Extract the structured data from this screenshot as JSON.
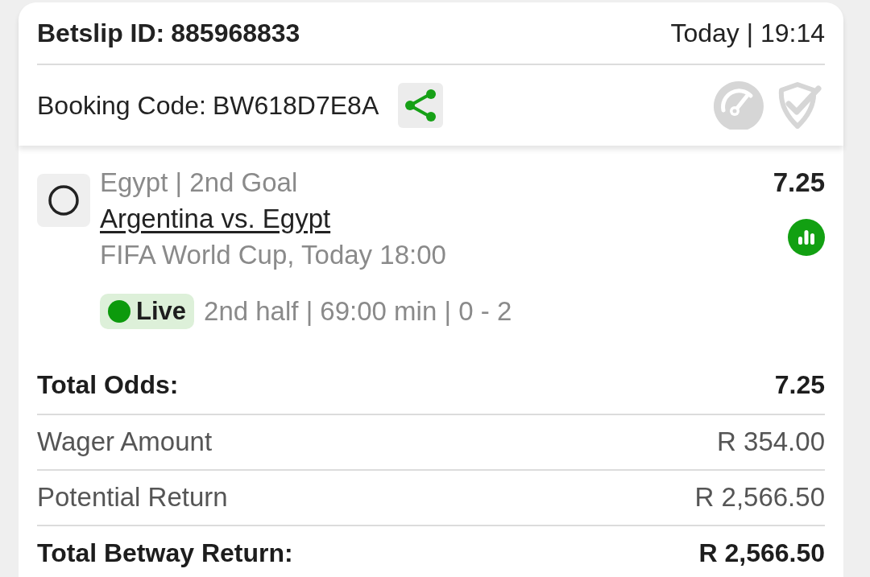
{
  "header": {
    "betslip_label": "Betslip ID:",
    "betslip_id": "885968833",
    "datetime": "Today | 19:14",
    "booking_label": "Booking Code:",
    "booking_code": "BW618D7E8A"
  },
  "selections": [
    {
      "market": "Egypt | 2nd Goal",
      "match": "Argentina vs. Egypt",
      "event": "FIFA World Cup, Today 18:00",
      "odds": "7.25",
      "status": {
        "label": "Live",
        "detail": "2nd half | 69:00 min | 0 - 2"
      }
    }
  ],
  "summary": [
    {
      "kind": "total",
      "label": "Total Odds:",
      "value": "7.25"
    },
    {
      "kind": "line",
      "label": "Wager Amount",
      "value": "R 354.00"
    },
    {
      "kind": "line",
      "label": "Potential Return",
      "value": "R 2,566.50"
    },
    {
      "kind": "total",
      "label": "Total Betway Return:",
      "value": "R 2,566.50"
    }
  ]
}
